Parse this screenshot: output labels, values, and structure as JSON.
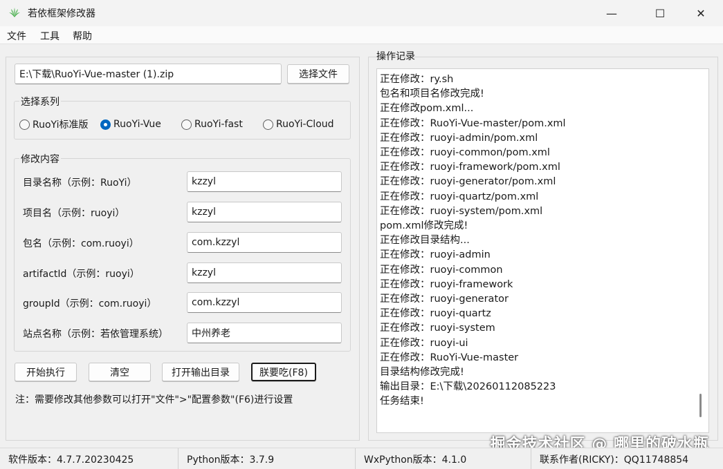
{
  "window": {
    "title": "若依框架修改器",
    "minimize_label": "—",
    "maximize_label": "☐",
    "close_label": "✕"
  },
  "menu": {
    "items": [
      "文件",
      "工具",
      "帮助"
    ]
  },
  "file_select": {
    "path_value": "E:\\下载\\RuoYi-Vue-master (1).zip",
    "choose_button": "选择文件"
  },
  "series": {
    "title": "选择系列",
    "options": [
      "RuoYi标准版",
      "RuoYi-Vue",
      "RuoYi-fast",
      "RuoYi-Cloud"
    ],
    "selected": "RuoYi-Vue"
  },
  "modify": {
    "title": "修改内容",
    "fields": [
      {
        "label": "目录名称（示例：RuoYi）",
        "value": "kzzyl"
      },
      {
        "label": "项目名（示例：ruoyi）",
        "value": "kzzyl"
      },
      {
        "label": "包名（示例：com.ruoyi）",
        "value": "com.kzzyl"
      },
      {
        "label": "artifactId（示例：ruoyi）",
        "value": "kzzyl"
      },
      {
        "label": "groupId（示例：com.ruoyi）",
        "value": "com.kzzyl"
      },
      {
        "label": "站点名称（示例：若依管理系统）",
        "value": "中州养老"
      }
    ]
  },
  "actions": {
    "start": "开始执行",
    "clear": "清空",
    "open_output": "打开输出目录",
    "eat": "朕要吃(F8)"
  },
  "note": "注：需要修改其他参数可以打开\"文件\">\"配置参数\"(F6)进行设置",
  "log": {
    "title": "操作记录",
    "lines": [
      "正在修改：ry.sh",
      "包名和项目名修改完成!",
      "正在修改pom.xml...",
      "正在修改：RuoYi-Vue-master/pom.xml",
      "正在修改：ruoyi-admin/pom.xml",
      "正在修改：ruoyi-common/pom.xml",
      "正在修改：ruoyi-framework/pom.xml",
      "正在修改：ruoyi-generator/pom.xml",
      "正在修改：ruoyi-quartz/pom.xml",
      "正在修改：ruoyi-system/pom.xml",
      "pom.xml修改完成!",
      "正在修改目录结构...",
      "正在修改：ruoyi-admin",
      "正在修改：ruoyi-common",
      "正在修改：ruoyi-framework",
      "正在修改：ruoyi-generator",
      "正在修改：ruoyi-quartz",
      "正在修改：ruoyi-system",
      "正在修改：ruoyi-ui",
      "正在修改：RuoYi-Vue-master",
      "目录结构修改完成!",
      "输出目录：E:\\下载\\20260112085223",
      "任务结束!"
    ]
  },
  "status": {
    "software_version": "软件版本：4.7.7.20230425",
    "python_version": "Python版本：3.7.9",
    "wxpython_version": "WxPython版本：4.1.0",
    "contact": "联系作者(RICKY)：QQ11748854"
  },
  "watermark": "掘金技术社区 @ 哪里的破水瓶",
  "colors": {
    "accent": "#0067c0"
  }
}
